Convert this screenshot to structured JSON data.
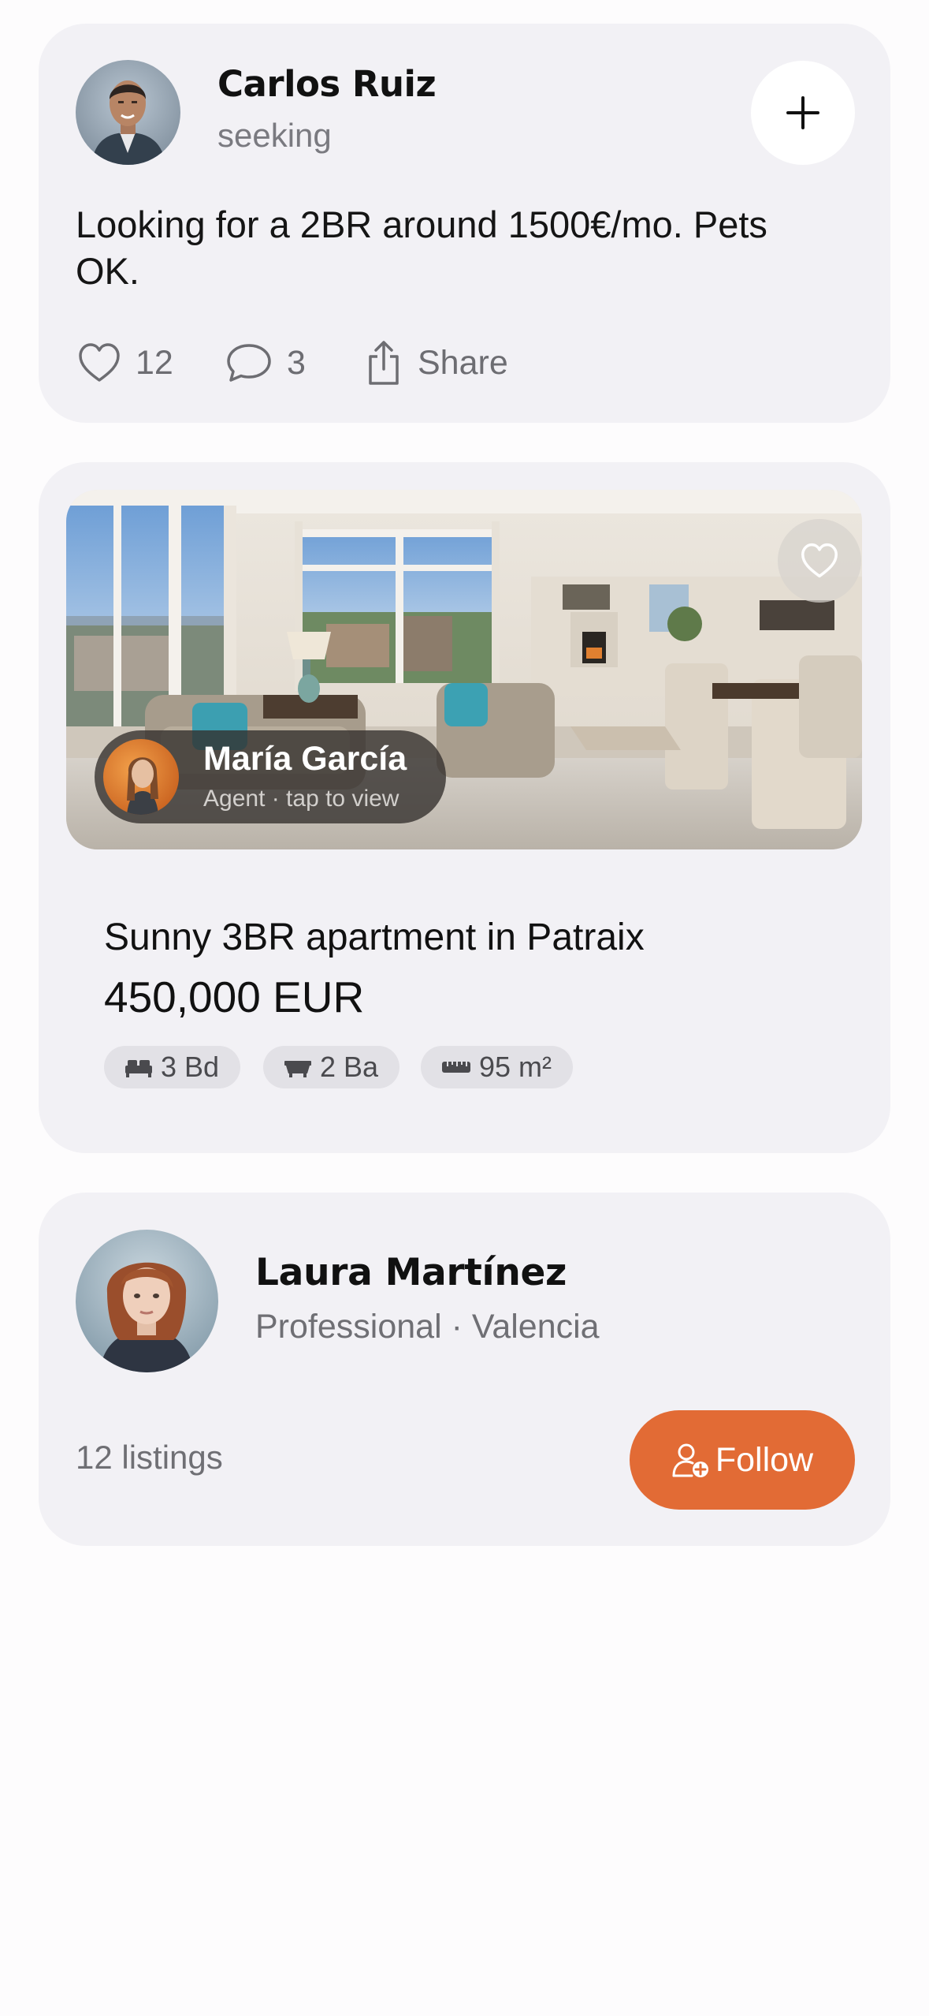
{
  "post": {
    "name": "Carlos Ruiz",
    "status": "seeking",
    "body": "Looking for a 2BR around 1500€/mo. Pets OK.",
    "likes": "12",
    "comments": "3",
    "share_label": "Share",
    "add_icon": "plus-icon"
  },
  "listing": {
    "agent_name": "María García",
    "agent_sub": "Agent · tap to view",
    "title": "Sunny 3BR apartment in Patraix",
    "price": "450,000 EUR",
    "chips": [
      {
        "icon": "bed-icon",
        "label": "3 Bd"
      },
      {
        "icon": "bathtub-icon",
        "label": "2 Ba"
      },
      {
        "icon": "ruler-icon",
        "label": "95 m²"
      }
    ],
    "favorite_icon": "heart-icon"
  },
  "profile": {
    "name": "Laura Martínez",
    "meta": "Professional · Valencia",
    "listings": "12 listings",
    "follow_label": "Follow"
  },
  "colors": {
    "accent": "#e26b35",
    "card_bg": "#f2f1f5",
    "chip_bg": "#e2e1e6",
    "muted_text": "#6f6f74"
  }
}
